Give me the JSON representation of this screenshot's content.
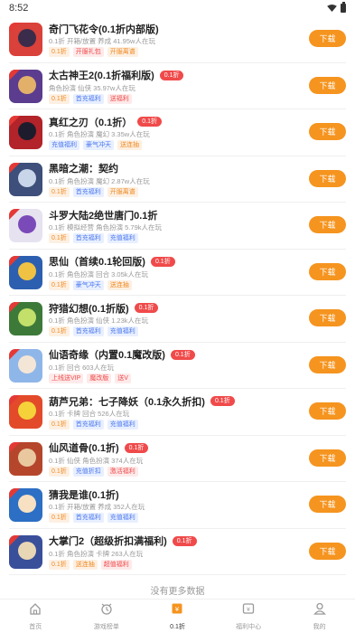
{
  "status_bar": {
    "time": "8:52"
  },
  "games": [
    {
      "title": "奇门飞花令(0.1折内部版)",
      "badge": "",
      "desc": "0.1折 开箱/放置 养成 41.95w人在玩",
      "tags": [
        "0.1折",
        "开服礼包",
        "开服离谱"
      ],
      "icon_colors": [
        "#d9413a",
        "#3a2c4a"
      ]
    },
    {
      "title": "太古神王2(0.1折福利版)",
      "badge": "0.1折",
      "desc": "角色扮演 仙侠 35.97w人在玩",
      "tags": [
        "0.1折",
        "首充福利",
        "送福利"
      ],
      "icon_colors": [
        "#5b3c8f",
        "#e3b06a"
      ]
    },
    {
      "title": "真红之刃（0.1折）",
      "badge": "0.1折",
      "desc": "0.1折 角色扮演 魔幻 3.35w人在玩",
      "tags": [
        "充值福利",
        "豪气冲天",
        "送连抽"
      ],
      "icon_colors": [
        "#b2232a",
        "#1c1c2c"
      ]
    },
    {
      "title": "黑暗之潮：契约",
      "badge": "",
      "desc": "0.1折 角色扮演 魔幻 2.87w人在玩",
      "tags": [
        "0.1折",
        "首充福利",
        "开服离谱"
      ],
      "icon_colors": [
        "#3d4f7a",
        "#c9d6ea"
      ]
    },
    {
      "title": "斗罗大陆2绝世唐门0.1折",
      "badge": "",
      "desc": "0.1折 模拟经营 角色扮演 5.79k人在玩",
      "tags": [
        "0.1折",
        "首充福利",
        "充值福利"
      ],
      "icon_colors": [
        "#e7e2f0",
        "#7a4ab8"
      ]
    },
    {
      "title": "思仙（首续0.1轮回版)",
      "badge": "0.1折",
      "desc": "0.1折 角色扮演 回合 3.05k人在玩",
      "tags": [
        "0.1折",
        "豪气冲天",
        "送连抽"
      ],
      "icon_colors": [
        "#2d5fb0",
        "#f0c244"
      ]
    },
    {
      "title": "狩猎幻想(0.1折版)",
      "badge": "0.1折",
      "desc": "0.1折 角色扮演 仙侠 1.23k人在玩",
      "tags": [
        "0.1折",
        "首充福利",
        "充值福利"
      ],
      "icon_colors": [
        "#3d7a3a",
        "#c3e06a"
      ]
    },
    {
      "title": "仙语奇缘（内置0.1魔改版)",
      "badge": "0.1折",
      "desc": "0.1折 回合 603人在玩",
      "tags": [
        "上线送VIP",
        "魔改版",
        "送V"
      ],
      "icon_colors": [
        "#8fb6e8",
        "#f4e6d6"
      ]
    },
    {
      "title": "葫芦兄弟：七子降妖（0.1永久折扣)",
      "badge": "0.1折",
      "desc": "0.1折 卡牌 回合 526人在玩",
      "tags": [
        "0.1折",
        "首充福利",
        "充值福利"
      ],
      "icon_colors": [
        "#e24a2a",
        "#f5d23a"
      ]
    },
    {
      "title": "仙风道骨(0.1折)",
      "badge": "0.1折",
      "desc": "0.1折 仙侠 角色扮演 374人在玩",
      "tags": [
        "0.1折",
        "充值折扣",
        "激活福利"
      ],
      "icon_colors": [
        "#b5462c",
        "#e9c8a0"
      ]
    },
    {
      "title": "猜我是谁(0.1折)",
      "badge": "",
      "desc": "0.1折 开箱/放置 养成 352人在玩",
      "tags": [
        "0.1折",
        "首充福利",
        "充值福利"
      ],
      "icon_colors": [
        "#2c6fc4",
        "#f7e1c2"
      ]
    },
    {
      "title": "大掌门2（超级折扣满福利)",
      "badge": "0.1折",
      "desc": "0.1折 角色扮演 卡牌 263人在玩",
      "tags": [
        "0.1折",
        "送连抽",
        "超值福利"
      ],
      "icon_colors": [
        "#3a4f9a",
        "#e8d7b4"
      ]
    }
  ],
  "download_label": "下载",
  "no_more_text": "没有更多数据",
  "tabs": [
    {
      "label": "首页",
      "icon": "home-icon"
    },
    {
      "label": "游戏榜单",
      "icon": "ranking-icon"
    },
    {
      "label": "0.1折",
      "icon": "discount-icon"
    },
    {
      "label": "福利中心",
      "icon": "welfare-icon"
    },
    {
      "label": "我的",
      "icon": "profile-icon"
    }
  ],
  "active_tab": "0.1折",
  "colors": {
    "accent": "#f5941f",
    "badge_red": "#f04a4a",
    "tag_orange": "#f08a24",
    "tag_blue": "#4a77f0",
    "tag_red": "#f04a4a"
  }
}
